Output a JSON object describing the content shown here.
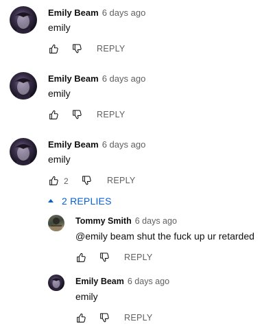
{
  "comments": [
    {
      "author": "Emily Beam",
      "time": "6 days ago",
      "text": "emily",
      "reply_label": "REPLY",
      "like_count": ""
    },
    {
      "author": "Emily Beam",
      "time": "6 days ago",
      "text": "emily",
      "reply_label": "REPLY",
      "like_count": ""
    },
    {
      "author": "Emily Beam",
      "time": "6 days ago",
      "text": "emily",
      "reply_label": "REPLY",
      "like_count": "2"
    }
  ],
  "replies_toggle": {
    "label": "2 REPLIES"
  },
  "replies": [
    {
      "author": "Tommy Smith",
      "time": "6 days ago",
      "text": "@emily beam shut the fuck up ur retarded",
      "reply_label": "REPLY"
    },
    {
      "author": "Emily Beam",
      "time": "6 days ago",
      "text": "emily",
      "reply_label": "REPLY"
    }
  ],
  "icons": {
    "like": "thumbs-up-icon",
    "dislike": "thumbs-down-icon",
    "expand": "caret-up-icon"
  },
  "colors": {
    "link_blue": "#065fd4",
    "secondary_text": "#606060"
  }
}
